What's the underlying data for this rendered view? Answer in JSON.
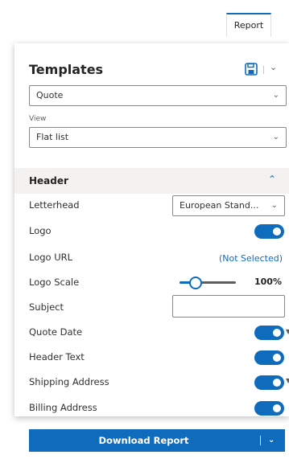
{
  "tab": {
    "report_label": "Report"
  },
  "panel": {
    "title": "Templates",
    "icons": {
      "save": "save-icon",
      "dropdown": "chevron-down-icon"
    },
    "template_select": {
      "value": "Quote"
    },
    "view": {
      "label": "View",
      "value": "Flat list"
    }
  },
  "header_section": {
    "title": "Header",
    "expanded": true,
    "rows": {
      "letterhead": {
        "label": "Letterhead",
        "value": "European Stand..."
      },
      "logo": {
        "label": "Logo",
        "enabled": true
      },
      "logo_url": {
        "label": "Logo URL",
        "value": "(Not Selected)"
      },
      "logo_scale": {
        "label": "Logo Scale",
        "value": "100%",
        "level": 0.3
      },
      "subject": {
        "label": "Subject",
        "value": ""
      },
      "quote_date": {
        "label": "Quote Date",
        "enabled": true
      },
      "header_text": {
        "label": "Header Text",
        "enabled": true
      },
      "shipping_address": {
        "label": "Shipping Address",
        "enabled": true
      },
      "billing_address": {
        "label": "Billing Address",
        "enabled": true
      }
    }
  },
  "download": {
    "label": "Download Report"
  },
  "colors": {
    "accent": "#0f6cbd",
    "text": "#323130",
    "section_bg": "#f3f2f1"
  }
}
